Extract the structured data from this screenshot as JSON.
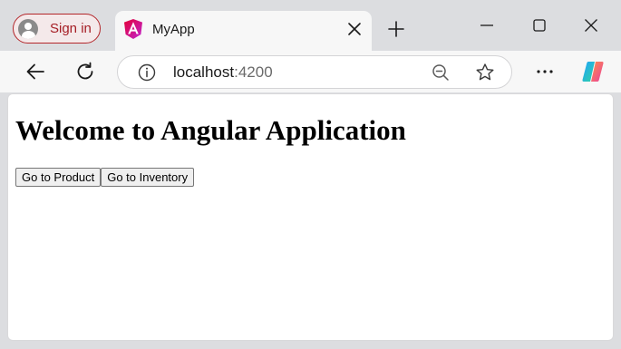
{
  "browser": {
    "profile": {
      "signin_label": "Sign in"
    },
    "tab": {
      "title": "MyApp",
      "favicon": "angular-icon"
    },
    "address_bar": {
      "host": "localhost",
      "port": ":4200"
    },
    "icons": {
      "back": "back-arrow-icon",
      "reload": "reload-icon",
      "site_info": "info-icon",
      "zoom": "zoom-out-icon",
      "favorite": "star-icon",
      "menu": "more-icon",
      "copilot": "copilot-icon"
    },
    "colors": {
      "signin_accent": "#a51d24",
      "angular_red": "#dd0031",
      "angular_magenta": "#e91e63"
    }
  },
  "page": {
    "heading": "Welcome to Angular Application",
    "buttons": [
      {
        "label": "Go to Product"
      },
      {
        "label": "Go to Inventory"
      }
    ]
  }
}
